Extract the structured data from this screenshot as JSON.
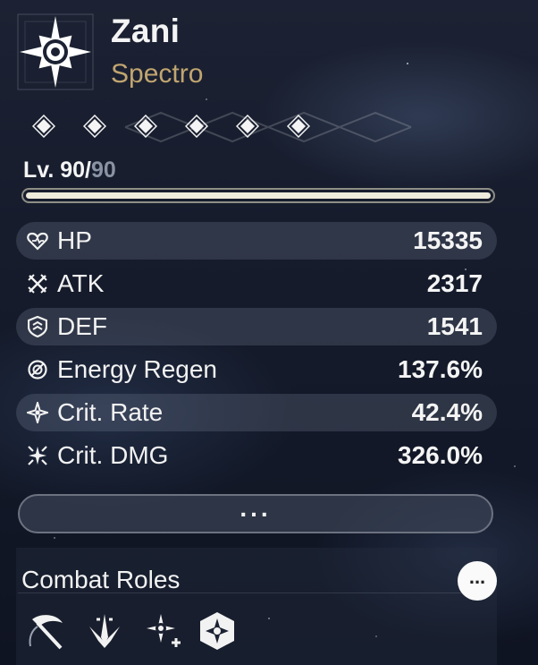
{
  "character": {
    "name": "Zani",
    "element": "Spectro",
    "element_color": "#c1a570",
    "emblem_icon": "spectro-sun-icon"
  },
  "sequence": {
    "nodes": 6,
    "node_icon": "diamond-icon"
  },
  "level": {
    "current": "Lv. 90/",
    "max": "90",
    "progress": 1.0
  },
  "stats": [
    {
      "icon": "hp-heart-icon",
      "label": "HP",
      "value": "15335"
    },
    {
      "icon": "atk-swords-icon",
      "label": "ATK",
      "value": "2317"
    },
    {
      "icon": "def-shield-icon",
      "label": "DEF",
      "value": "1541"
    },
    {
      "icon": "energy-regen-icon",
      "label": "Energy Regen",
      "value": "137.6%"
    },
    {
      "icon": "crit-rate-icon",
      "label": "Crit. Rate",
      "value": "42.4%"
    },
    {
      "icon": "crit-dmg-icon",
      "label": "Crit. DMG",
      "value": "326.0%"
    }
  ],
  "more_button": {
    "label": "..."
  },
  "combat_roles": {
    "title": "Combat Roles",
    "more_label": "...",
    "roles": [
      "scythe-role-icon",
      "blade-burst-role-icon",
      "spectro-plus-role-icon",
      "spectro-hex-role-icon"
    ]
  }
}
